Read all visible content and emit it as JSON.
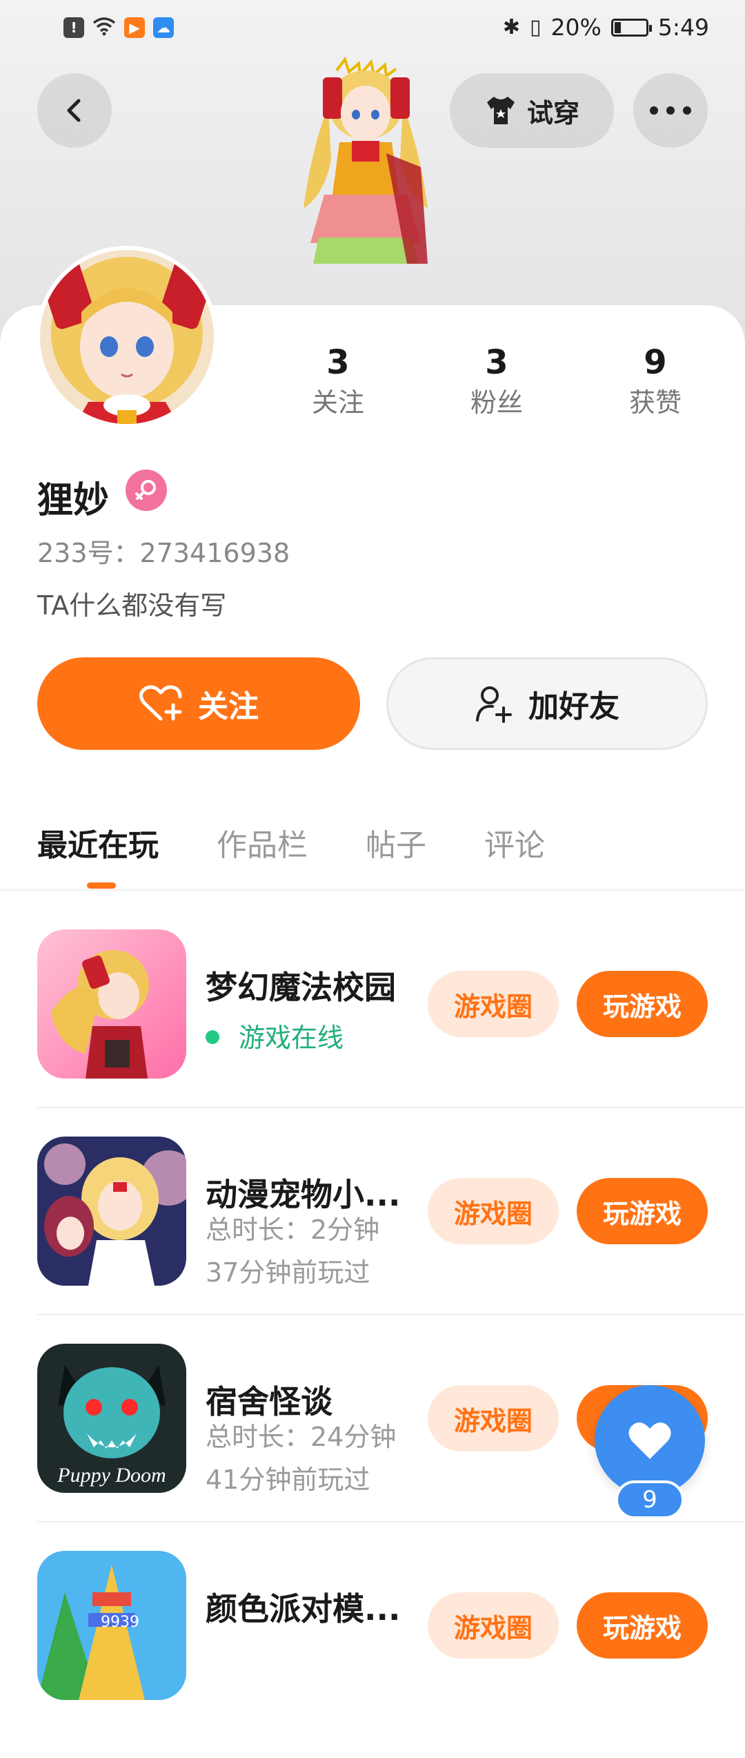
{
  "status_bar": {
    "battery": "20%",
    "time": "5:49"
  },
  "header": {
    "try_on_label": "试穿"
  },
  "profile": {
    "stats": [
      {
        "num": "3",
        "label": "关注"
      },
      {
        "num": "3",
        "label": "粉丝"
      },
      {
        "num": "9",
        "label": "获赞"
      }
    ],
    "name": "狸妙",
    "uid": "233号：273416938",
    "bio": "TA什么都没有写"
  },
  "actions": {
    "follow_label": "关注",
    "add_friend_label": "加好友"
  },
  "tabs": [
    {
      "label": "最近在玩",
      "active": true
    },
    {
      "label": "作品栏",
      "active": false
    },
    {
      "label": "帖子",
      "active": false
    },
    {
      "label": "评论",
      "active": false
    }
  ],
  "games": [
    {
      "title": "梦幻魔法校园",
      "line1": "游戏在线",
      "line2": "",
      "circle_label": "游戏圈",
      "play_label": "玩游戏"
    },
    {
      "title": "动漫宠物小...",
      "line1": "总时长：2分钟",
      "line2": "37分钟前玩过",
      "circle_label": "游戏圈",
      "play_label": "玩游戏"
    },
    {
      "title": "宿舍怪谈",
      "line1": "总时长：24分钟",
      "line2": "41分钟前玩过",
      "circle_label": "游戏圈",
      "play_label": "玩游戏",
      "icon_text": "Puppy Doom"
    },
    {
      "title": "颜色派对模...",
      "line1": "",
      "line2": "",
      "circle_label": "游戏圈",
      "play_label": "玩游戏",
      "icon_text": "9939"
    }
  ],
  "fab": {
    "like_count": "9"
  },
  "colors": {
    "accent": "#ff7315",
    "accent_light": "#ffe8da",
    "online": "#22b07a",
    "fab": "#3d8ef0",
    "gender": "#f2729b"
  }
}
